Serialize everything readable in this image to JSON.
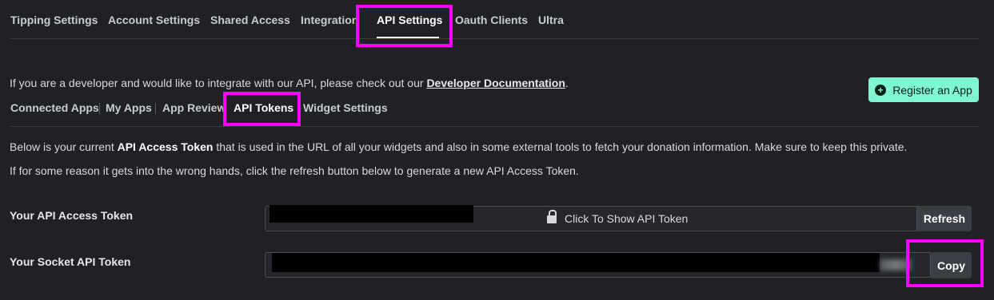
{
  "tabs": [
    {
      "label": "Tipping Settings"
    },
    {
      "label": "Account Settings"
    },
    {
      "label": "Shared Access"
    },
    {
      "label": "Integration"
    },
    {
      "label": "API Settings",
      "active": true
    },
    {
      "label": "Oauth Clients"
    },
    {
      "label": "Ultra"
    }
  ],
  "intro": {
    "text": "If you are a developer and would like to integrate with our API, please check out our ",
    "link": "Developer Documentation",
    "suffix": "."
  },
  "register_button": {
    "label": "Register an App",
    "icon": "plus-circle-icon",
    "color": "#80f5d2"
  },
  "subtabs": [
    {
      "label": "Connected Apps"
    },
    {
      "label": "My Apps"
    },
    {
      "label": "App Review"
    },
    {
      "label": "API Tokens",
      "active": true
    },
    {
      "label": "Widget Settings"
    }
  ],
  "description": {
    "line1_pre": "Below is your current ",
    "line1_bold": "API Access Token",
    "line1_post": " that is used in the URL of all your widgets and also in some external tools to fetch your donation information. Make sure to keep this private.",
    "line2": "If for some reason it gets into the wrong hands, click the refresh button below to generate a new API Access Token."
  },
  "api_token": {
    "label": "Your API Access Token",
    "show_text": "Click To Show API Token",
    "refresh_label": "Refresh"
  },
  "socket_token": {
    "label": "Your Socket API Token",
    "copy_label": "Copy"
  },
  "colors": {
    "background": "#1f2125",
    "highlight": "#ff00ff",
    "accent": "#80f5d2"
  }
}
